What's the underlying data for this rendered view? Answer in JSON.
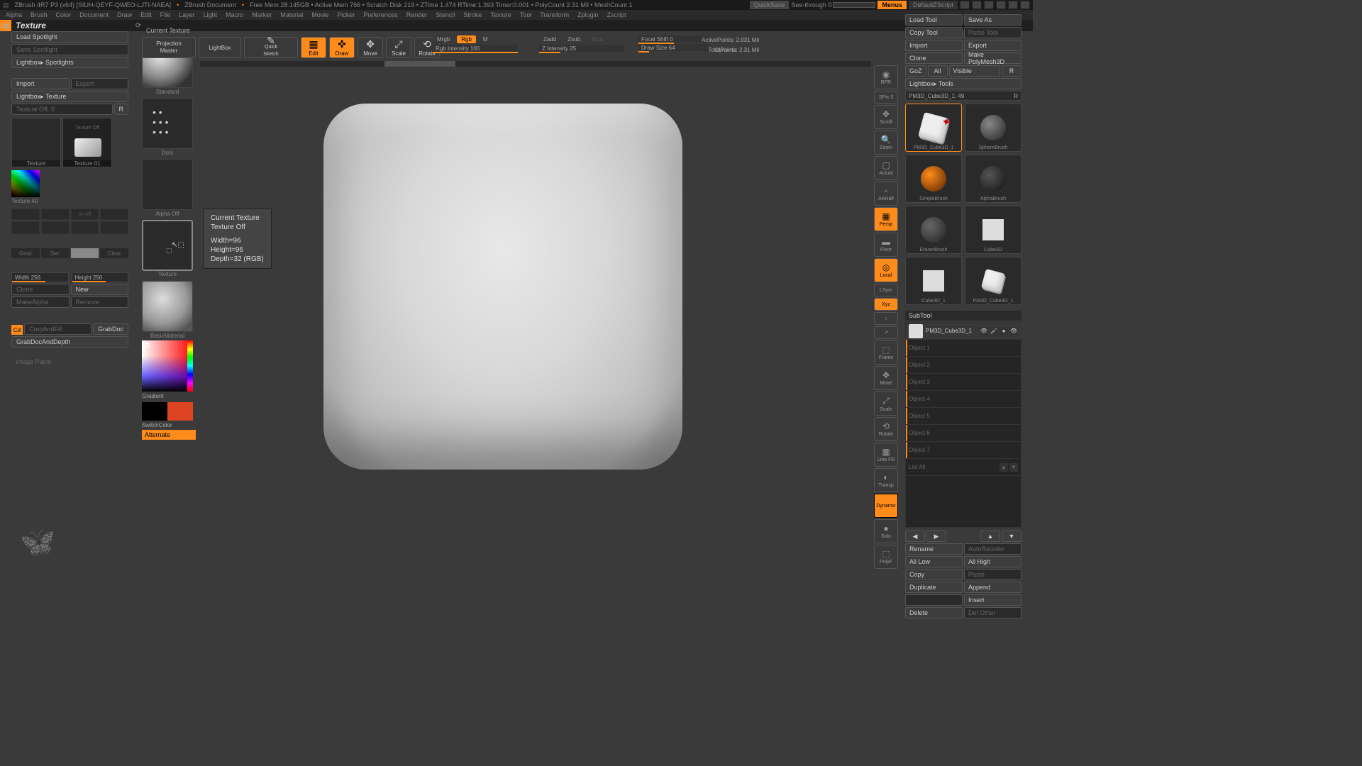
{
  "titlebar": {
    "app": "ZBrush 4R7 P3 (x64) [SIUH-QEYF-QWEO-LJTI-NAEA]",
    "doc": "ZBrush Document",
    "stats": "Free Mem 28.145GB  •  Active Mem 766  •  Scratch Disk 219  •  ZTime 1.474  RTime:1.393  Timer:0.001  •  PolyCount 2.31 Mil  •  MeshCount 1",
    "quicksave": "QuickSave",
    "seethrough": "See-through  0",
    "menus": "Menus",
    "script": "DefaultZScript"
  },
  "menubar": [
    "Alpha",
    "Brush",
    "Color",
    "Document",
    "Draw",
    "Edit",
    "File",
    "Layer",
    "Light",
    "Macro",
    "Marker",
    "Material",
    "Movie",
    "Picker",
    "Preferences",
    "Render",
    "Stencil",
    "Stroke",
    "Texture",
    "Tool",
    "Transform",
    "Zplugin",
    "Zscript"
  ],
  "palette_title": "Texture",
  "left": {
    "load_spotlight": "Load Spotlight",
    "save_spotlight": "Save Spotlight",
    "lightbox_spot": "Lightbox▸ Spotlights",
    "import": "Import",
    "export": "Export",
    "lightbox_tex": "Lightbox▸ Texture",
    "texoff": "Texture Off. 0",
    "r": "R",
    "texture_thumb": "Texture",
    "texture01_thumb": "Texture 01",
    "texture40": "Texture 40",
    "grad_labels": [
      "Grad",
      "Sec",
      "",
      "Clear"
    ],
    "width": "Width 256",
    "height": "Height 256",
    "clone": "Clone",
    "new": "New",
    "makealpha": "MakeAlpha",
    "remove": "Remove",
    "cd": "Cd",
    "cropfill": "CropAndFill",
    "grabdoc": "GrabDoc",
    "grabdepth": "GrabDocAndDepth",
    "imageplane": "Image Plane",
    "onoff": "on off"
  },
  "shelf": {
    "standard": "Standard",
    "dots": "Dots",
    "alpha_off": "Alpha Off",
    "texture": "Texture",
    "material": "BasicMaterial",
    "gradient": "Gradient",
    "switchcolor": "SwitchColor",
    "alternate": "Alternate"
  },
  "toolbar": {
    "current_texture": "Current Texture",
    "projection": "Projection\nMaster",
    "lightbox": "LightBox",
    "quicksketch": "Quick\nSketch",
    "edit": "Edit",
    "draw": "Draw",
    "move": "Move",
    "scale": "Scale",
    "rotate": "Rotate",
    "mrgb": "Mrgb",
    "rgb": "Rgb",
    "m": "M",
    "rgb_intensity": "Rgb Intensity 100",
    "zadd": "Zadd",
    "zsub": "Zsub",
    "zcut": "Zcut",
    "z_intensity": "Z Intensity 25",
    "focal": "Focal Shift 0",
    "drawsize": "Draw Size 64",
    "dynamic": "Dynamic",
    "activepoints": "ActivePoints: 2.031 Mil",
    "totalpoints": "TotalPoints: 2.31 Mil"
  },
  "tooltip": {
    "l1": "Current Texture",
    "l2": "Texture Off",
    "l3": "Width=96",
    "l4": "Height=96",
    "l5": "Depth=32 (RGB)"
  },
  "rside": [
    "BPR",
    "SPix 3",
    "Scroll",
    "Zoom",
    "Actual",
    "AAHalf",
    "Persp",
    "Floor",
    "Local",
    "LSym",
    "Xyz",
    "",
    "",
    "Frame",
    "Move",
    "Scale",
    "Rotate",
    "Line Fill",
    "",
    "Transp",
    "",
    "Dynamic",
    "Solo",
    "PolyF"
  ],
  "right": {
    "load_tool": "Load Tool",
    "save_as": "Save As",
    "copy_tool": "Copy Tool",
    "paste_tool": "Paste Tool",
    "import": "Import",
    "export": "Export",
    "clone": "Clone",
    "make_polymesh": "Make PolyMesh3D",
    "goz": "GoZ",
    "all": "All",
    "visible": "Visible",
    "r": "R",
    "lightbox_tools": "Lightbox▸ Tools",
    "toolname": "PM3D_Cube3D_1. 49",
    "tools": [
      "PM3D_Cube3D_1",
      "SphereBrush",
      "SimpleBrush",
      "AlphaBrush",
      "EraserBrush",
      "Cube3D",
      "Cube3D_1",
      "PM3D_Cube3D_1"
    ],
    "subtool": "SubTool",
    "sub_active": "PM3D_Cube3D_1",
    "sub_empty": [
      "Object 1",
      "Object 2",
      "Object 3",
      "Object 4",
      "Object 5",
      "Object 6",
      "Object 7"
    ],
    "list_all": "List All",
    "rename": "Rename",
    "autoreorder": "AutoReorder",
    "all_low": "All Low",
    "all_high": "All High",
    "copy": "Copy",
    "paste": "Paste",
    "duplicate": "Duplicate",
    "append": "Append",
    "insert": "Insert",
    "delete": "Delete",
    "del_other": "Del Other"
  }
}
